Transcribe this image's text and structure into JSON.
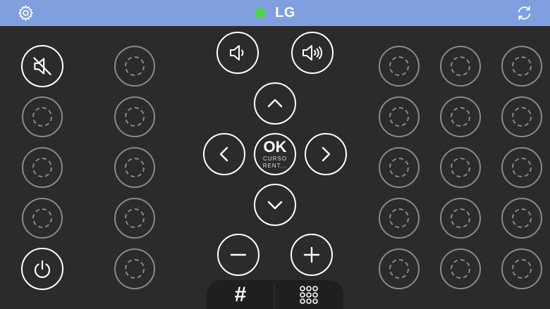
{
  "header": {
    "title": "LG",
    "status_color": "#47d647",
    "left_icon": "gear-icon",
    "right_icon": "refresh-icon"
  },
  "center": {
    "ok_label": "OK",
    "ok_sub": "CURSO RENT..."
  },
  "bottom_bar": {
    "hash_label": "#",
    "keypad_icon": "keypad-grid-icon"
  },
  "icons": {
    "mute": "mute-icon",
    "power": "power-icon",
    "volume_down": "volume-down-icon",
    "volume_up": "volume-up-icon",
    "up": "chevron-up-icon",
    "down": "chevron-down-icon",
    "left": "chevron-left-icon",
    "right": "chevron-right-icon",
    "minus": "minus-icon",
    "plus": "plus-icon"
  }
}
